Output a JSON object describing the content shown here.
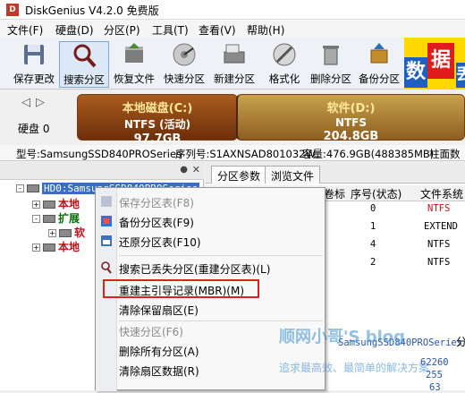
{
  "window": {
    "title": "DiskGenius V4.2.0 免费版",
    "app_icon_glyph": "D"
  },
  "menu": [
    "文件(F)",
    "硬盘(D)",
    "分区(P)",
    "工具(T)",
    "查看(V)",
    "帮助(H)"
  ],
  "toolbar": [
    {
      "label": "保存更改",
      "icon": "save-icon"
    },
    {
      "label": "搜索分区",
      "icon": "search-icon"
    },
    {
      "label": "恢复文件",
      "icon": "recover-files-icon"
    },
    {
      "label": "快速分区",
      "icon": "quick-partition-icon"
    },
    {
      "label": "新建分区",
      "icon": "new-partition-icon"
    },
    {
      "label": "格式化",
      "icon": "format-icon"
    },
    {
      "label": "删除分区",
      "icon": "delete-partition-icon"
    },
    {
      "label": "备份分区",
      "icon": "backup-partition-icon"
    }
  ],
  "banner": {
    "c1": "数",
    "c2": "据",
    "c3": "丢"
  },
  "disk": {
    "label": "硬盘 0",
    "partitions": [
      {
        "name": "本地磁盘(C:)",
        "fs": "NTFS (活动)",
        "size": "97.7GB"
      },
      {
        "name": "软件(D:)",
        "fs": "NTFS",
        "size": "204.8GB"
      }
    ]
  },
  "info": {
    "model": "型号:SamsungSSD840PROSeries",
    "serial": "序列号:S1AXNSAD801032W",
    "capacity": "容量:476.9GB(488385MB)",
    "cyl": "柱面数"
  },
  "tree": {
    "disk_node": "HD0:SamsungSSD840PROSeries",
    "nodes": [
      "本地",
      "扩展",
      "软",
      "本地"
    ]
  },
  "tabs": [
    "分区参数",
    "浏览文件"
  ],
  "grid": {
    "headers": [
      "卷标",
      "序号(状态)",
      "文件系统"
    ],
    "rows": [
      {
        "idx": "0",
        "fs": "NTFS"
      },
      {
        "idx": "1",
        "fs": "EXTEND"
      },
      {
        "idx": "4",
        "fs": "NTFS"
      },
      {
        "idx": "2",
        "fs": "NTFS"
      }
    ],
    "lower_cells": [
      "SamsungSSD840PROSeries",
      "62260",
      "255",
      "63"
    ],
    "side_char": "分"
  },
  "context_menu": [
    {
      "label": "保存分区表(F8)",
      "disabled": true
    },
    {
      "label": "备份分区表(F9)",
      "disabled": false
    },
    {
      "label": "还原分区表(F10)",
      "disabled": false
    },
    {
      "label": "搜索已丢失分区(重建分区表)(L)",
      "disabled": false
    },
    {
      "label": "重建主引导记录(MBR)(M)",
      "disabled": false
    },
    {
      "label": "清除保留扇区(E)",
      "disabled": false
    },
    {
      "label": "快速分区(F6)",
      "disabled": true
    },
    {
      "label": "删除所有分区(A)",
      "disabled": false
    },
    {
      "label": "清除扇区数据(R)",
      "disabled": false
    }
  ],
  "watermark": {
    "main": "顺网小哥'S blog",
    "sub": "追求最高效、最简单的解决方案"
  },
  "colors": {
    "accent": "#3a6ec4",
    "highlight_box": "#d9231f",
    "partition_c": "#8a4716",
    "partition_d": "#b18640"
  }
}
